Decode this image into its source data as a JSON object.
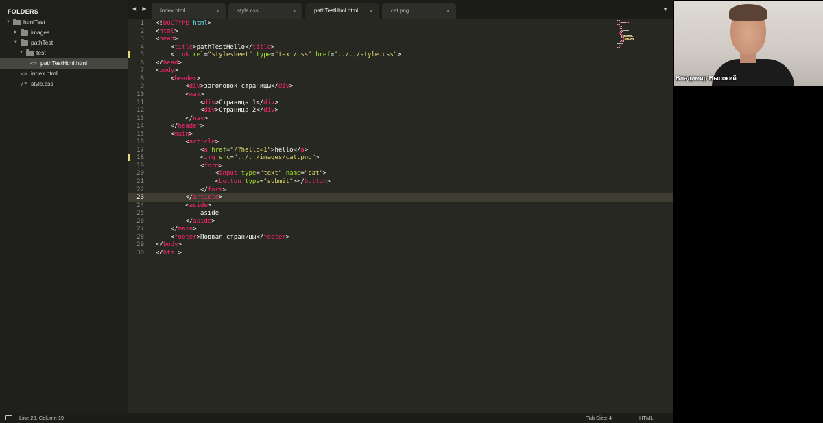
{
  "sidebar": {
    "title": "FOLDERS",
    "items": [
      {
        "label": "htmlTest",
        "kind": "folder",
        "expanded": true,
        "depth": 0
      },
      {
        "label": "images",
        "kind": "folder",
        "expanded": false,
        "depth": 1
      },
      {
        "label": "pathTest",
        "kind": "folder",
        "expanded": true,
        "depth": 1
      },
      {
        "label": "test",
        "kind": "folder",
        "expanded": true,
        "depth": 2
      },
      {
        "label": "pathTestHtml.html",
        "kind": "html-file",
        "depth": 3,
        "active": true
      },
      {
        "label": "index.html",
        "kind": "html-file",
        "depth": 1
      },
      {
        "label": "style.css",
        "kind": "css-file",
        "depth": 1
      }
    ]
  },
  "tabs": {
    "nav_arrows": "◀ ▶",
    "dropdown": "▼",
    "items": [
      {
        "label": "index.html",
        "active": false
      },
      {
        "label": "style.css",
        "active": false
      },
      {
        "label": "pathTestHtml.html",
        "active": true
      },
      {
        "label": "cat.png",
        "active": false
      }
    ],
    "close_glyph": "×"
  },
  "editor": {
    "current_line": 23,
    "modified_lines": [
      5,
      18
    ],
    "lines": [
      [
        [
          "punc",
          "<!"
        ],
        [
          "tag",
          "DOCTYPE"
        ],
        [
          "text",
          " "
        ],
        [
          "doc",
          "html"
        ],
        [
          "punc",
          ">"
        ]
      ],
      [
        [
          "punc",
          "<"
        ],
        [
          "tag",
          "html"
        ],
        [
          "punc",
          ">"
        ]
      ],
      [
        [
          "punc",
          "<"
        ],
        [
          "tag",
          "head"
        ],
        [
          "punc",
          ">"
        ]
      ],
      [
        [
          "text",
          "    "
        ],
        [
          "punc",
          "<"
        ],
        [
          "tag",
          "title"
        ],
        [
          "punc",
          ">"
        ],
        [
          "text",
          "pathTestHello"
        ],
        [
          "punc",
          "</"
        ],
        [
          "tag",
          "title"
        ],
        [
          "punc",
          ">"
        ]
      ],
      [
        [
          "text",
          "    "
        ],
        [
          "punc",
          "<"
        ],
        [
          "tag",
          "link"
        ],
        [
          "text",
          " "
        ],
        [
          "attr",
          "rel"
        ],
        [
          "punc",
          "="
        ],
        [
          "str",
          "\"stylesheet\""
        ],
        [
          "text",
          " "
        ],
        [
          "attr",
          "type"
        ],
        [
          "punc",
          "="
        ],
        [
          "str",
          "\"text/css\""
        ],
        [
          "text",
          " "
        ],
        [
          "attr",
          "href"
        ],
        [
          "punc",
          "="
        ],
        [
          "str",
          "\"../../style.css\""
        ],
        [
          "punc",
          ">"
        ]
      ],
      [
        [
          "punc",
          "</"
        ],
        [
          "tag",
          "head"
        ],
        [
          "punc",
          ">"
        ]
      ],
      [
        [
          "punc",
          "<"
        ],
        [
          "tag",
          "body"
        ],
        [
          "punc",
          ">"
        ]
      ],
      [
        [
          "text",
          "    "
        ],
        [
          "punc",
          "<"
        ],
        [
          "tag",
          "header"
        ],
        [
          "punc",
          ">"
        ]
      ],
      [
        [
          "text",
          "        "
        ],
        [
          "punc",
          "<"
        ],
        [
          "tag",
          "div"
        ],
        [
          "punc",
          ">"
        ],
        [
          "text",
          "заголовок страницы"
        ],
        [
          "punc",
          "</"
        ],
        [
          "tag",
          "div"
        ],
        [
          "punc",
          ">"
        ]
      ],
      [
        [
          "text",
          "        "
        ],
        [
          "punc",
          "<"
        ],
        [
          "tag",
          "nav"
        ],
        [
          "punc",
          ">"
        ]
      ],
      [
        [
          "text",
          "            "
        ],
        [
          "punc",
          "<"
        ],
        [
          "tag",
          "div"
        ],
        [
          "punc",
          ">"
        ],
        [
          "text",
          "Страница 1"
        ],
        [
          "punc",
          "</"
        ],
        [
          "tag",
          "div"
        ],
        [
          "punc",
          ">"
        ]
      ],
      [
        [
          "text",
          "            "
        ],
        [
          "punc",
          "<"
        ],
        [
          "tag",
          "div"
        ],
        [
          "punc",
          ">"
        ],
        [
          "text",
          "Страница 2"
        ],
        [
          "punc",
          "</"
        ],
        [
          "tag",
          "div"
        ],
        [
          "punc",
          ">"
        ]
      ],
      [
        [
          "text",
          "        "
        ],
        [
          "punc",
          "</"
        ],
        [
          "tag",
          "nav"
        ],
        [
          "punc",
          ">"
        ]
      ],
      [
        [
          "text",
          "    "
        ],
        [
          "punc",
          "</"
        ],
        [
          "tag",
          "header"
        ],
        [
          "punc",
          ">"
        ]
      ],
      [
        [
          "text",
          "    "
        ],
        [
          "punc",
          "<"
        ],
        [
          "tag",
          "main"
        ],
        [
          "punc",
          ">"
        ]
      ],
      [
        [
          "text",
          "        "
        ],
        [
          "punc",
          "<"
        ],
        [
          "tag",
          "article"
        ],
        [
          "punc",
          ">"
        ]
      ],
      [
        [
          "text",
          "            "
        ],
        [
          "punc",
          "<"
        ],
        [
          "tag",
          "a"
        ],
        [
          "text",
          " "
        ],
        [
          "attr",
          "href"
        ],
        [
          "punc",
          "="
        ],
        [
          "str",
          "\"/?hello=1\""
        ],
        [
          "punc",
          ">"
        ],
        [
          "text",
          "hello"
        ],
        [
          "punc",
          "</"
        ],
        [
          "tag",
          "a"
        ],
        [
          "punc",
          ">"
        ]
      ],
      [
        [
          "text",
          "            "
        ],
        [
          "punc",
          "<"
        ],
        [
          "tag",
          "img"
        ],
        [
          "text",
          " "
        ],
        [
          "attr",
          "src"
        ],
        [
          "punc",
          "="
        ],
        [
          "str",
          "\"../../images/cat.png\""
        ],
        [
          "punc",
          ">"
        ]
      ],
      [
        [
          "text",
          "            "
        ],
        [
          "punc",
          "<"
        ],
        [
          "tag",
          "form"
        ],
        [
          "punc",
          ">"
        ]
      ],
      [
        [
          "text",
          "                "
        ],
        [
          "punc",
          "<"
        ],
        [
          "tag",
          "input"
        ],
        [
          "text",
          " "
        ],
        [
          "attr",
          "type"
        ],
        [
          "punc",
          "="
        ],
        [
          "str",
          "\"text\""
        ],
        [
          "text",
          " "
        ],
        [
          "attr",
          "name"
        ],
        [
          "punc",
          "="
        ],
        [
          "str",
          "\"cat\""
        ],
        [
          "punc",
          ">"
        ]
      ],
      [
        [
          "text",
          "                "
        ],
        [
          "punc",
          "<"
        ],
        [
          "tag",
          "button"
        ],
        [
          "text",
          " "
        ],
        [
          "attr",
          "type"
        ],
        [
          "punc",
          "="
        ],
        [
          "str",
          "\"submit\""
        ],
        [
          "punc",
          "></"
        ],
        [
          "tag",
          "button"
        ],
        [
          "punc",
          ">"
        ]
      ],
      [
        [
          "text",
          "            "
        ],
        [
          "punc",
          "</"
        ],
        [
          "tag",
          "form"
        ],
        [
          "punc",
          ">"
        ]
      ],
      [
        [
          "text",
          "        "
        ],
        [
          "punc",
          "</"
        ],
        [
          "tag",
          "article"
        ],
        [
          "punc",
          ">"
        ]
      ],
      [
        [
          "text",
          "        "
        ],
        [
          "punc",
          "<"
        ],
        [
          "tag",
          "aside"
        ],
        [
          "punc",
          ">"
        ]
      ],
      [
        [
          "text",
          "            aside"
        ]
      ],
      [
        [
          "text",
          "        "
        ],
        [
          "punc",
          "</"
        ],
        [
          "tag",
          "aside"
        ],
        [
          "punc",
          ">"
        ]
      ],
      [
        [
          "text",
          "    "
        ],
        [
          "punc",
          "</"
        ],
        [
          "tag",
          "main"
        ],
        [
          "punc",
          ">"
        ]
      ],
      [
        [
          "text",
          "    "
        ],
        [
          "punc",
          "<"
        ],
        [
          "tag",
          "footer"
        ],
        [
          "punc",
          ">"
        ],
        [
          "text",
          "Подвал страницы"
        ],
        [
          "punc",
          "</"
        ],
        [
          "tag",
          "footer"
        ],
        [
          "punc",
          ">"
        ]
      ],
      [
        [
          "punc",
          "</"
        ],
        [
          "tag",
          "body"
        ],
        [
          "punc",
          ">"
        ]
      ],
      [
        [
          "punc",
          "</"
        ],
        [
          "tag",
          "html"
        ],
        [
          "punc",
          ">"
        ]
      ]
    ]
  },
  "statusbar": {
    "position": "Line 23, Column 19",
    "tab_size": "Tab Size: 4",
    "syntax": "HTML"
  },
  "webcam": {
    "presenter_name": "Владимир Высокий"
  },
  "colors": {
    "tag": "#f92672",
    "attr": "#a6e22e",
    "str": "#e6db74",
    "doc": "#66d9ef",
    "text": "#f8f8f2",
    "background": "#272822"
  }
}
